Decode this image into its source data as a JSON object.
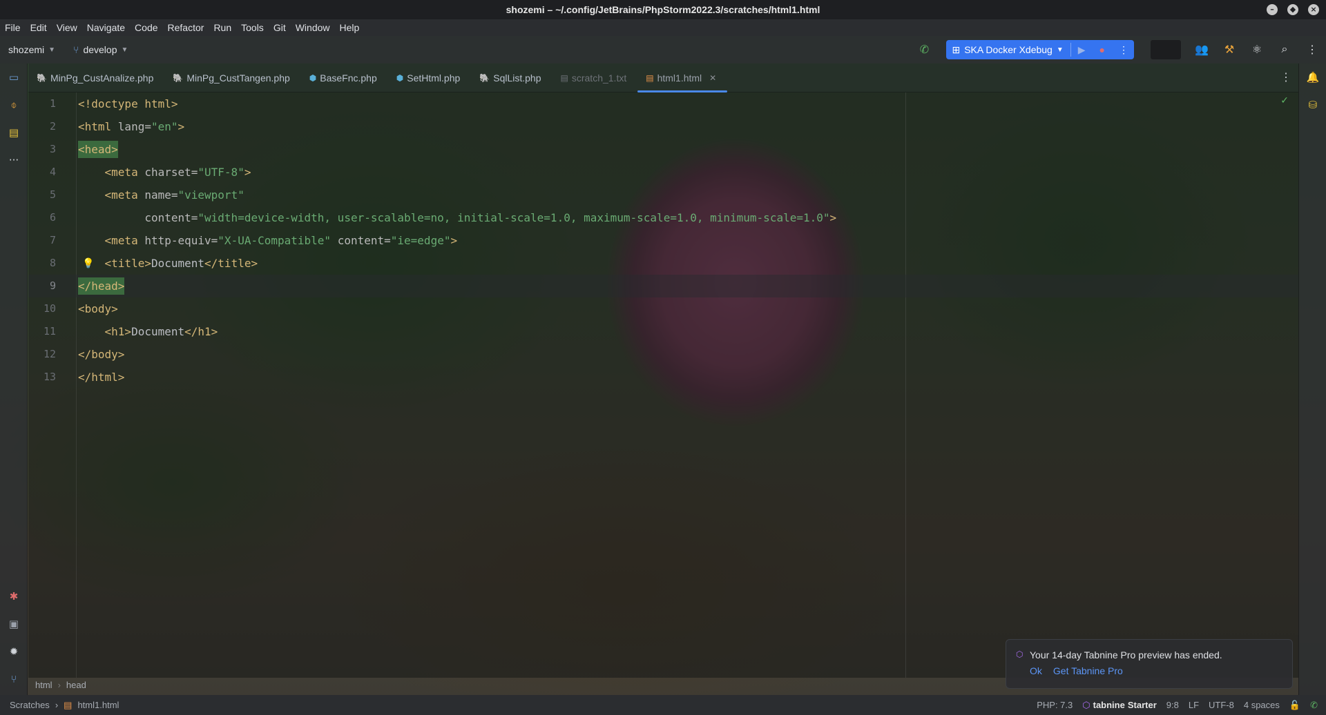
{
  "window": {
    "title": "shozemi – ~/.config/JetBrains/PhpStorm2022.3/scratches/html1.html"
  },
  "menu": [
    "File",
    "Edit",
    "View",
    "Navigate",
    "Code",
    "Refactor",
    "Run",
    "Tools",
    "Git",
    "Window",
    "Help"
  ],
  "toolbar": {
    "project": "shozemi",
    "branch": "develop",
    "run_config": "SKA Docker Xdebug"
  },
  "tabs": [
    {
      "label": "MinPg_CustAnalize.php",
      "icon": "php-elephant-icon"
    },
    {
      "label": "MinPg_CustTangen.php",
      "icon": "php-elephant-icon"
    },
    {
      "label": "BaseFnc.php",
      "icon": "php-class-icon"
    },
    {
      "label": "SetHtml.php",
      "icon": "php-class-icon"
    },
    {
      "label": "SqlList.php",
      "icon": "php-elephant-icon"
    },
    {
      "label": "scratch_1.txt",
      "icon": "text-file-icon"
    },
    {
      "label": "html1.html",
      "icon": "html-file-icon",
      "active": true
    }
  ],
  "editor": {
    "line_numbers": [
      "1",
      "2",
      "3",
      "4",
      "5",
      "6",
      "7",
      "8",
      "9",
      "10",
      "11",
      "12",
      "13"
    ],
    "current_line": 9,
    "lines": {
      "l1": "<!doctype html>",
      "l2_open": "<html ",
      "l2_attr": "lang=",
      "l2_val": "\"en\"",
      "l2_close": ">",
      "l3": "<head>",
      "l4_open": "    <meta ",
      "l4_attr": "charset=",
      "l4_val": "\"UTF-8\"",
      "l4_close": ">",
      "l5_open": "    <meta ",
      "l5_attr": "name=",
      "l5_val": "\"viewport\"",
      "l6_attr": "          content=",
      "l6_val": "\"width=device-width, user-scalable=no, initial-scale=1.0, maximum-scale=1.0, minimum-scale=1.0\"",
      "l6_close": ">",
      "l7_open": "    <meta ",
      "l7_attr1": "http-equiv=",
      "l7_val1": "\"X-UA-Compatible\"",
      "l7_attr2": " content=",
      "l7_val2": "\"ie=edge\"",
      "l7_close": ">",
      "l8_open": "    <title>",
      "l8_text": "Document",
      "l8_close": "</title>",
      "l9": "</head>",
      "l10": "<body>",
      "l11_open": "    <h1>",
      "l11_text": "Document",
      "l11_close": "</h1>",
      "l12": "</body>",
      "l13": "</html>"
    }
  },
  "breadcrumb": [
    "html",
    "head"
  ],
  "notification": {
    "text": "Your 14-day Tabnine Pro preview has ended.",
    "ok": "Ok",
    "get_pro": "Get Tabnine Pro"
  },
  "statusbar": {
    "scope": "Scratches",
    "file": "html1.html",
    "php": "PHP: 7.3",
    "tabnine_brand": "tabnine",
    "tabnine_plan": "Starter",
    "position": "9:8",
    "line_sep": "LF",
    "encoding": "UTF-8",
    "indent": "4 spaces"
  },
  "colors": {
    "accent": "#3574f0",
    "tag": "#d5b778",
    "string": "#6aab73",
    "match_highlight": "#3b6a3e"
  }
}
